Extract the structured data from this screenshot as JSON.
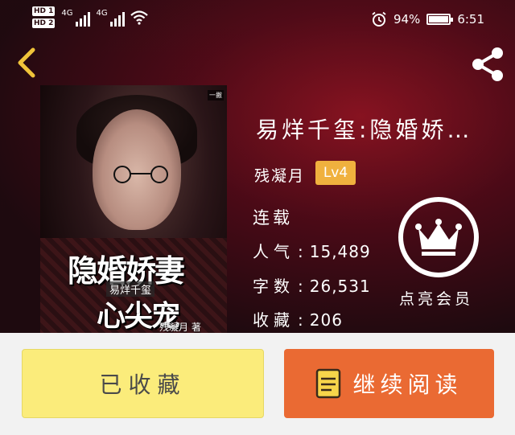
{
  "status_bar": {
    "hd1": "HD 1",
    "hd2": "HD 2",
    "net1": "4G",
    "net2": "4G",
    "battery": "94%",
    "time": "6:51"
  },
  "book": {
    "title": "易烊千玺:隐婚娇…",
    "author": "残凝月",
    "level": "Lv4",
    "status": "连载",
    "stats": [
      {
        "key": "人气",
        "value": "15,489"
      },
      {
        "key": "字数",
        "value": "26,531"
      },
      {
        "key": "收藏",
        "value": "206"
      }
    ],
    "cover": {
      "tag": "一撇",
      "title_line1": "隐婚娇妻",
      "subtitle": "易烊千玺",
      "title_line2": "心尖宠",
      "author": "残凝月 著"
    }
  },
  "vip": {
    "label": "点亮会员"
  },
  "actions": {
    "collected": "已收藏",
    "continue_reading": "继续阅读"
  },
  "colors": {
    "level_badge": "#f0b13e",
    "collected_button": "#fbec7b",
    "read_button": "#ea6a33",
    "read_icon": "#f7d54a"
  }
}
